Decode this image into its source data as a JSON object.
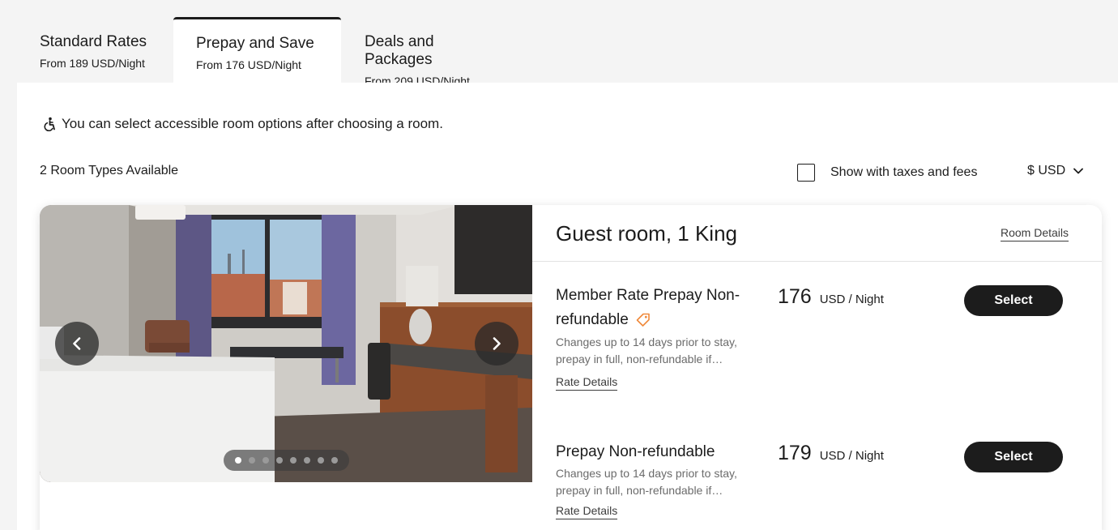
{
  "tabs": [
    {
      "title": "Standard Rates",
      "subtitle": "From 189 USD/Night"
    },
    {
      "title": "Prepay and Save",
      "subtitle": "From 176 USD/Night"
    },
    {
      "title": "Deals and Packages",
      "subtitle": "From 209 USD/Night"
    }
  ],
  "accessibility_note": "You can select accessible room options after choosing a room.",
  "room_count": "2 Room Types Available",
  "taxes_toggle": {
    "label": "Show with taxes and fees",
    "checked": false
  },
  "currency": {
    "label": "$ USD"
  },
  "room": {
    "title": "Guest room, 1 King",
    "details_link": "Room Details",
    "photo_count": 8,
    "active_photo": 1,
    "rates": [
      {
        "name": "Member Rate Prepay Non-refundable",
        "has_tag_icon": true,
        "description": "Changes up to 14 days prior to stay, prepay in full, non-refundable if…",
        "details_link": "Rate Details",
        "price": "176",
        "unit": "USD / Night",
        "button": "Select"
      },
      {
        "name": "Prepay Non-refundable",
        "has_tag_icon": false,
        "description": "Changes up to 14 days prior to stay, prepay in full, non-refundable if…",
        "details_link": "Rate Details",
        "price": "179",
        "unit": "USD / Night",
        "button": "Select"
      }
    ]
  },
  "colors": {
    "accent": "#1c1c1c",
    "tag_icon": "#f08a3c",
    "page_bg": "#f4f4f4"
  }
}
